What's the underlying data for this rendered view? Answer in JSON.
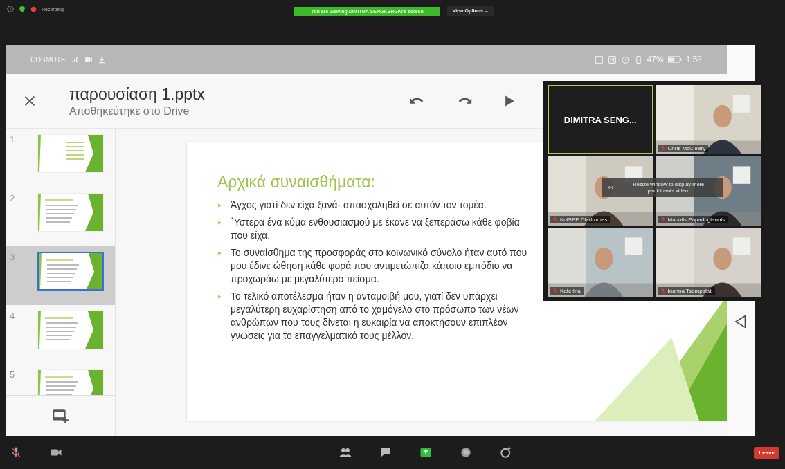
{
  "meeting_top_bar": {
    "recording_label": "Recording",
    "viewing_banner": "You are viewing DIMITRA SENGKERGKI's screen",
    "view_options": "View Options ⌄"
  },
  "phone_status_bar": {
    "carrier": "COSMOTE",
    "battery": "47%",
    "time": "1:59"
  },
  "document": {
    "title": "παρουσίαση 1.pptx",
    "subtitle": "Αποθηκεύτηκε στο Drive"
  },
  "slides": [
    {
      "number": "1",
      "selected": false
    },
    {
      "number": "2",
      "selected": false
    },
    {
      "number": "3",
      "selected": true
    },
    {
      "number": "4",
      "selected": false
    },
    {
      "number": "5",
      "selected": false
    }
  ],
  "slide": {
    "title": "Αρχικά συναισθήματα:",
    "bullets": [
      "Άγχος γιατί δεν είχα ξανά- απασχοληθεί σε αυτόν τον τομέα.",
      "΄Υστερα ένα κύμα ενθουσιασμού με έκανε να ξεπεράσω κάθε φοβία που είχα.",
      "Το συναίσθημα της προσφοράς στο κοινωνικό σύνολο ήταν αυτό που μου έδινε ώθηση κάθε φορά που αντιμετώπιζα κάποιο εμπόδιο να προχωράω με μεγαλύτερο πείσμα.",
      "Το τελικό αποτέλεσμα ήταν η ανταμοιβή μου, γιατί δεν υπάρχει μεγαλύτερη ευχαρίστηση από το χαμόγελο στο πρόσωπο των νέων ανθρώπων που τους δίνεται η ευκαιρία να αποκτήσουν επιπλέον γνώσεις για το επαγγελματικό τους μέλλον."
    ]
  },
  "video_gallery": {
    "tooltip": "Resize window to display more participants video.",
    "tiles": [
      {
        "kind": "name",
        "name": "DIMITRA  SENG...",
        "active": true
      },
      {
        "kind": "video",
        "name": "Chris McCleary",
        "muted": true,
        "active": false
      },
      {
        "kind": "video",
        "name": "KoiSPE Diadromes",
        "muted": true,
        "active": false
      },
      {
        "kind": "video",
        "name": "Manolis Papadogiannis",
        "muted": true,
        "active": false
      },
      {
        "kind": "video",
        "name": "Katerina",
        "muted": true,
        "active": false
      },
      {
        "kind": "video",
        "name": "Ioanna Tsampalati",
        "muted": true,
        "active": false
      }
    ]
  },
  "meeting_toolbar": {
    "leave": "Leave"
  }
}
